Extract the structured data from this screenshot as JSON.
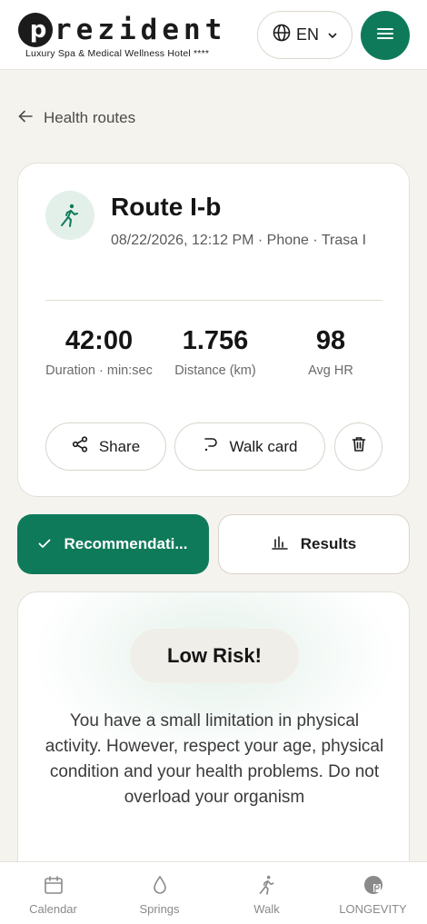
{
  "header": {
    "logo_mark": "p",
    "logo_word": "rezident",
    "logo_tagline": "Luxury Spa & Medical Wellness Hotel ****",
    "language": "EN",
    "language_icon": "globe-icon",
    "menu_icon": "hamburger-icon"
  },
  "back_link": {
    "label": "Health routes",
    "icon": "arrow-left-icon"
  },
  "route": {
    "icon": "walking-person-icon",
    "title": "Route I-b",
    "meta": "08/22/2026, 12:12 PM · Phone · Trasa I",
    "stats": [
      {
        "value": "42:00",
        "label": "Duration · min:sec"
      },
      {
        "value": "1.756",
        "label": "Distance (km)"
      },
      {
        "value": "98",
        "label": "Avg HR"
      }
    ],
    "actions": {
      "share_label": "Share",
      "walk_card_label": "Walk card"
    }
  },
  "tabs": {
    "recommendations": "Recommendati...",
    "results": "Results"
  },
  "recommendation": {
    "risk": "Low Risk!",
    "text": "You have a small limitation in physical activity. However, respect your age, physical condition and your health problems. Do not overload your organism"
  },
  "bottom_nav": [
    {
      "label": "Calendar",
      "icon": "calendar-icon"
    },
    {
      "label": "Springs",
      "icon": "droplet-icon"
    },
    {
      "label": "Walk",
      "icon": "walking-person-icon"
    },
    {
      "label": "LONGEVITY",
      "icon": "longevity-logo-icon"
    }
  ],
  "colors": {
    "accent": "#0f7a5a",
    "background": "#f5f3ee",
    "card": "#ffffff"
  }
}
